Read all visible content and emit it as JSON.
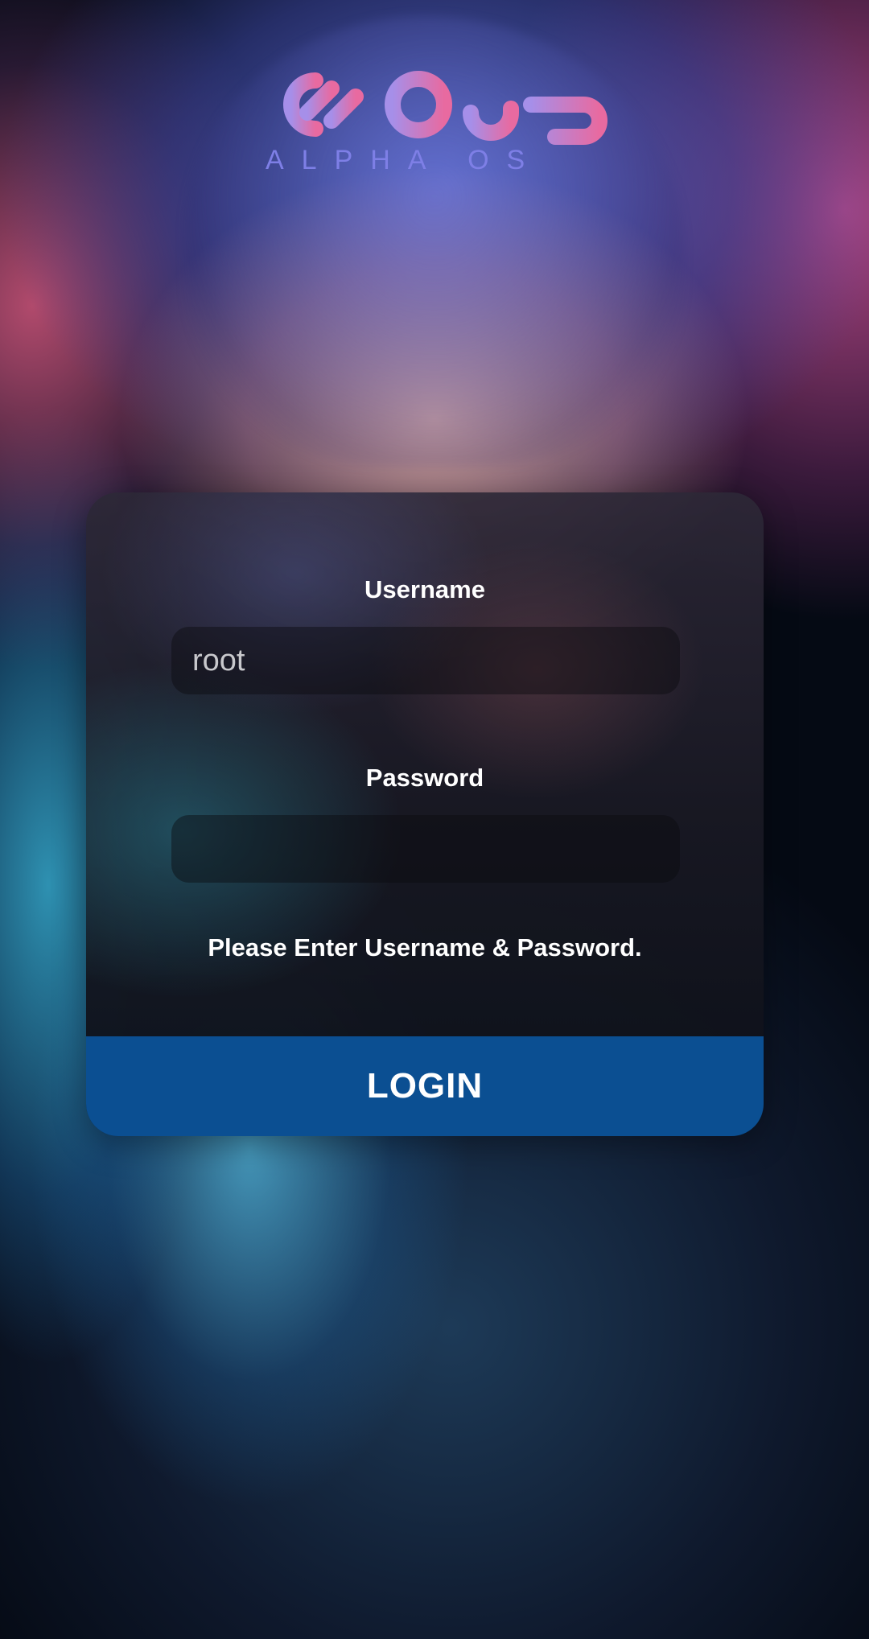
{
  "logo": {
    "subtitle": "ALPHA OS"
  },
  "login": {
    "username_label": "Username",
    "username_value": "root",
    "password_label": "Password",
    "password_value": "",
    "hint": "Please Enter Username & Password.",
    "button_label": "LOGIN"
  },
  "colors": {
    "button": "#0b4f92",
    "logo_gradient_start": "#9b86e8",
    "logo_gradient_end": "#e86aa0"
  }
}
